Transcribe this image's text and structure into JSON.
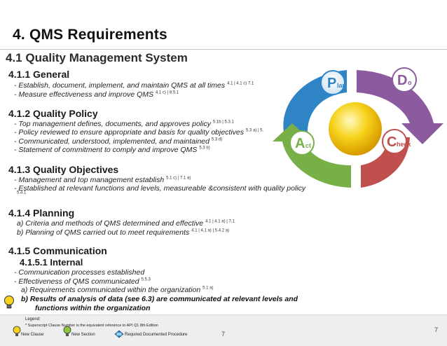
{
  "slide_title": "4. QMS Requirements",
  "section_title": "4.1 Quality Management System",
  "sections": {
    "general": {
      "heading": "4.1.1 General",
      "items": [
        {
          "text": "- Establish, document, implement, and maintain QMS at all times",
          "ref": "4.1 | 4.1 c) 7.1"
        },
        {
          "text": "- Measure effectiveness and improve QMS",
          "ref": "4.1 c) | 8.5.1"
        }
      ]
    },
    "policy": {
      "heading": "4.1.2 Quality Policy",
      "items": [
        {
          "text": "- Top management defines, documents, and approves policy",
          "ref": "5.1b | 5.3.1"
        },
        {
          "text": "- Policy reviewed to ensure appropriate and basis for quality objectives",
          "ref": "5.3 a) | 5."
        },
        {
          "text": "- Communicated, understood, implemented, and maintained",
          "ref": "5.3 d)"
        },
        {
          "text": "- Statement of commitment to comply and improve QMS",
          "ref": "5.3 b)"
        }
      ]
    },
    "objectives": {
      "heading": "4.1.3 Quality Objectives",
      "items": [
        {
          "text": "- Management and top management establish",
          "ref": "5.1 c) | 7.1 a)"
        },
        {
          "text": "- Established at relevant functions and levels, measureable &consistent with quality policy",
          "ref": ""
        }
      ],
      "trailing_ref": "5.4.1"
    },
    "planning": {
      "heading": "4.1.4 Planning",
      "items": [
        {
          "text": "a)  Criteria and methods of QMS determined and effective",
          "ref": "4.1 | 4.1 a) | 7.1"
        },
        {
          "text": "b)  Planning of QMS carried out to meet requirements",
          "ref": "4.1 | 4.1 a) | 5.4.2 a)"
        }
      ]
    },
    "communication": {
      "heading": "4.1.5 Communication",
      "sub_heading": "4.1.5.1 Internal",
      "items": [
        {
          "text": "- Communication processes established",
          "ref": ""
        },
        {
          "text": "- Effectiveness of QMS communicated",
          "ref": "5.5.3"
        },
        {
          "text": "a)  Requirements communicated within the organization",
          "ref": "5.1 a)"
        }
      ],
      "new_item_line1": "b)  Results of analysis of data (see 6.3) are communicated at relevant levels and",
      "new_item_line2": "functions within the organization"
    }
  },
  "pdca": {
    "plan": {
      "letter": "P",
      "rest": "lan"
    },
    "do": {
      "letter": "D",
      "rest": "o"
    },
    "check": {
      "letter": "C",
      "rest": "heck"
    },
    "act": {
      "letter": "A",
      "rest": "ct"
    }
  },
  "footer": {
    "legend_label": "Legend:",
    "legend_note": "* Superscript Clause Number is the equivalent reference to API Q1 8th Edition",
    "new_clause": "New Clause",
    "new_section": "New Section",
    "required_procedure": "Required Documented Procedure",
    "page_center": "7",
    "page_right": "7"
  },
  "colors": {
    "plan": "#2f84c6",
    "do": "#8c5a9e",
    "check": "#c0504d",
    "act": "#76b047",
    "sun": "#f6c400",
    "bulb_yellow": "#f5d31e",
    "bulb_green": "#8dc63f"
  }
}
